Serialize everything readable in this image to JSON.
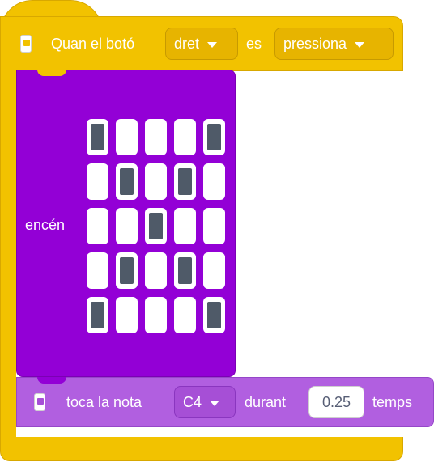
{
  "event_block": {
    "prefix": "Quan el botó",
    "button_value": "dret",
    "middle": "es",
    "action_value": "pressiona",
    "icon": "microbit-icon"
  },
  "led_block": {
    "label": "encén",
    "matrix": [
      [
        1,
        0,
        0,
        0,
        1
      ],
      [
        0,
        1,
        0,
        1,
        0
      ],
      [
        0,
        0,
        1,
        0,
        0
      ],
      [
        0,
        1,
        0,
        1,
        0
      ],
      [
        1,
        0,
        0,
        0,
        1
      ]
    ]
  },
  "note_block": {
    "prefix": "toca la nota",
    "note_value": "C4",
    "middle": "durant",
    "duration_value": "0.25",
    "suffix": "temps",
    "icon": "microbit-icon"
  },
  "colors": {
    "event_yellow": "#f2c200",
    "led_purple": "#9300d6",
    "note_purple": "#b15fe0",
    "led_on": "#4f5a68"
  }
}
